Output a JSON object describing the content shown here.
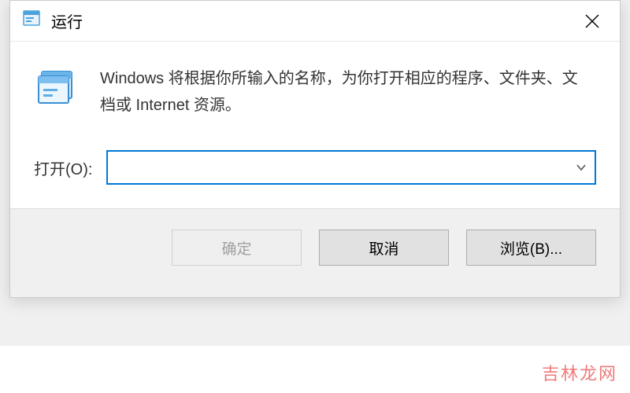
{
  "dialog": {
    "title": "运行",
    "description": "Windows 将根据你所输入的名称，为你打开相应的程序、文件夹、文档或 Internet 资源。",
    "open_label": "打开(O):",
    "input_value": "",
    "buttons": {
      "ok": "确定",
      "cancel": "取消",
      "browse": "浏览(B)..."
    }
  },
  "watermark": "吉林龙网"
}
